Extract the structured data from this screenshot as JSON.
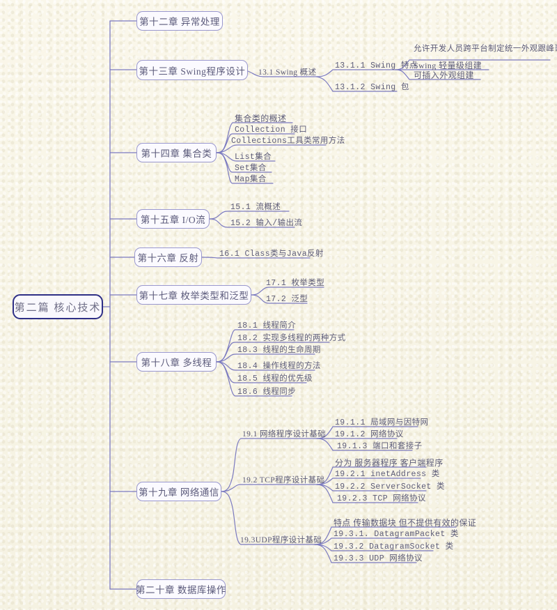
{
  "meta": {
    "title": "第二篇 核心技术",
    "background_color": "#f7f4e6",
    "line_color": "#7b7ac0",
    "root_border_color": "#2e2f86",
    "node_border_color": "#9a98cf",
    "text_color": "#5d5c78"
  },
  "root": {
    "label": "第二篇 核心技术"
  },
  "chapters": [
    {
      "label": "第十二章 异常处理",
      "sections": []
    },
    {
      "label": "第十三章 Swing程序设计",
      "sections": [
        {
          "label": "13.1 Swing 概述",
          "items": [
            {
              "label": "13.1.1 Swing 特点",
              "items": [
                {
                  "label": "允许开发人员跨平台制定统一外观跟峰哥"
                },
                {
                  "label": "Swing 轻量级组建"
                },
                {
                  "label": "可插入外观组建"
                }
              ]
            },
            {
              "label": "13.1.2 Swing 包",
              "items": []
            }
          ]
        }
      ]
    },
    {
      "label": "第十四章 集合类",
      "items": [
        {
          "label": "集合类的概述"
        },
        {
          "label": "Collection 接口"
        },
        {
          "label": "Collections工具类常用方法"
        },
        {
          "label": "List集合"
        },
        {
          "label": "Set集合"
        },
        {
          "label": "Map集合"
        }
      ]
    },
    {
      "label": "第十五章 I/O流",
      "items": [
        {
          "label": "15.1 流概述"
        },
        {
          "label": "15.2 输入/输出流"
        }
      ]
    },
    {
      "label": "第十六章 反射",
      "items": [
        {
          "label": "16.1 Class类与Java反射"
        }
      ]
    },
    {
      "label": "第十七章 枚举类型和泛型",
      "items": [
        {
          "label": "17.1 枚举类型"
        },
        {
          "label": "17.2 泛型"
        }
      ]
    },
    {
      "label": "第十八章 多线程",
      "items": [
        {
          "label": "18.1 线程简介"
        },
        {
          "label": "18.2 实现多线程的两种方式"
        },
        {
          "label": "18.3 线程的生命周期"
        },
        {
          "label": "18.4 操作线程的方法"
        },
        {
          "label": "18.5 线程的优先级"
        },
        {
          "label": "18.6 线程同步"
        }
      ]
    },
    {
      "label": "第十九章 网络通信",
      "sections": [
        {
          "label": "19.1 网络程序设计基础",
          "items": [
            {
              "label": "19.1.1 局域网与因特网"
            },
            {
              "label": "19.1.2 网络协议"
            },
            {
              "label": "19.1.3 端口和套接子"
            }
          ]
        },
        {
          "label": "19.2 TCP程序设计基础",
          "items": [
            {
              "label": "分为 服务器程序 客户端程序"
            },
            {
              "label": "19.2.1 inetAddress 类"
            },
            {
              "label": "19.2.2 ServerSocket 类"
            },
            {
              "label": "19.2.3 TCP 网络协议"
            }
          ]
        },
        {
          "label": "19.3UDP程序设计基础",
          "items": [
            {
              "label": "特点 传输数据块 但不提供有效的保证"
            },
            {
              "label": "19.3.1. DatagramPacket 类"
            },
            {
              "label": "19.3.2 DatagramSocket 类"
            },
            {
              "label": "19.3.3 UDP 网络协议"
            }
          ]
        }
      ]
    },
    {
      "label": "第二十章 数据库操作",
      "sections": []
    }
  ]
}
